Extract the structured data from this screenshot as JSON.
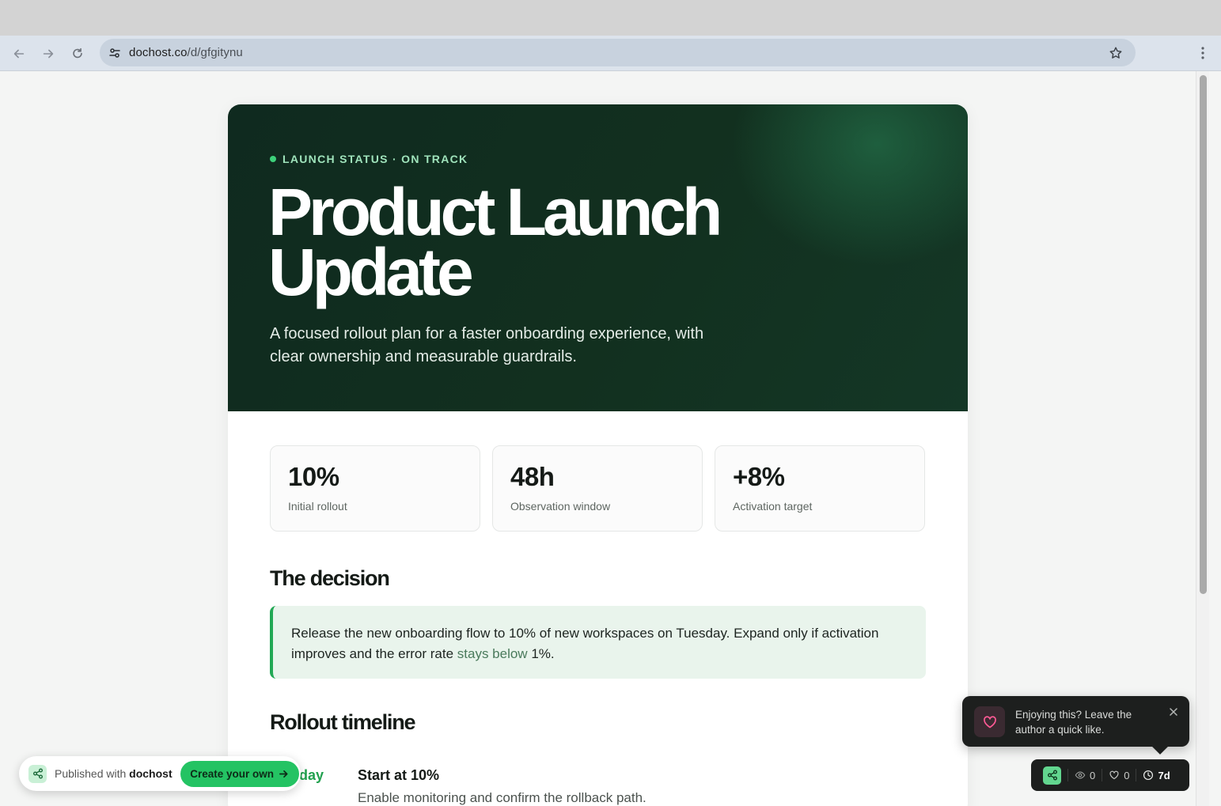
{
  "browser": {
    "url_host": "dochost.co",
    "url_path": "/d/gfgitynu"
  },
  "hero": {
    "status": "LAUNCH STATUS · ON TRACK",
    "title_line1": "Product Launch",
    "title_line2": "Update",
    "subtitle": "A focused rollout plan for a faster onboarding experience, with clear ownership and measurable guardrails."
  },
  "metrics": [
    {
      "value": "10%",
      "label": "Initial rollout"
    },
    {
      "value": "48h",
      "label": "Observation window"
    },
    {
      "value": "+8%",
      "label": "Activation target"
    }
  ],
  "decision": {
    "title": "The decision",
    "text_before": "Release the new onboarding flow to 10% of new workspaces on Tuesday. Expand only if activation improves and the error rate ",
    "text_highlight": "stays below",
    "text_after": " 1%."
  },
  "timeline": {
    "title": "Rollout timeline",
    "items": [
      {
        "day": "day",
        "heading": "Start at 10%",
        "description": "Enable monitoring and confirm the rollback path."
      }
    ]
  },
  "published": {
    "prefix": "Published with",
    "brand": "dochost",
    "cta": "Create your own"
  },
  "like_popup": {
    "message": "Enjoying this? Leave the author a quick like."
  },
  "stats": {
    "views": "0",
    "likes": "0",
    "age": "7d"
  }
}
